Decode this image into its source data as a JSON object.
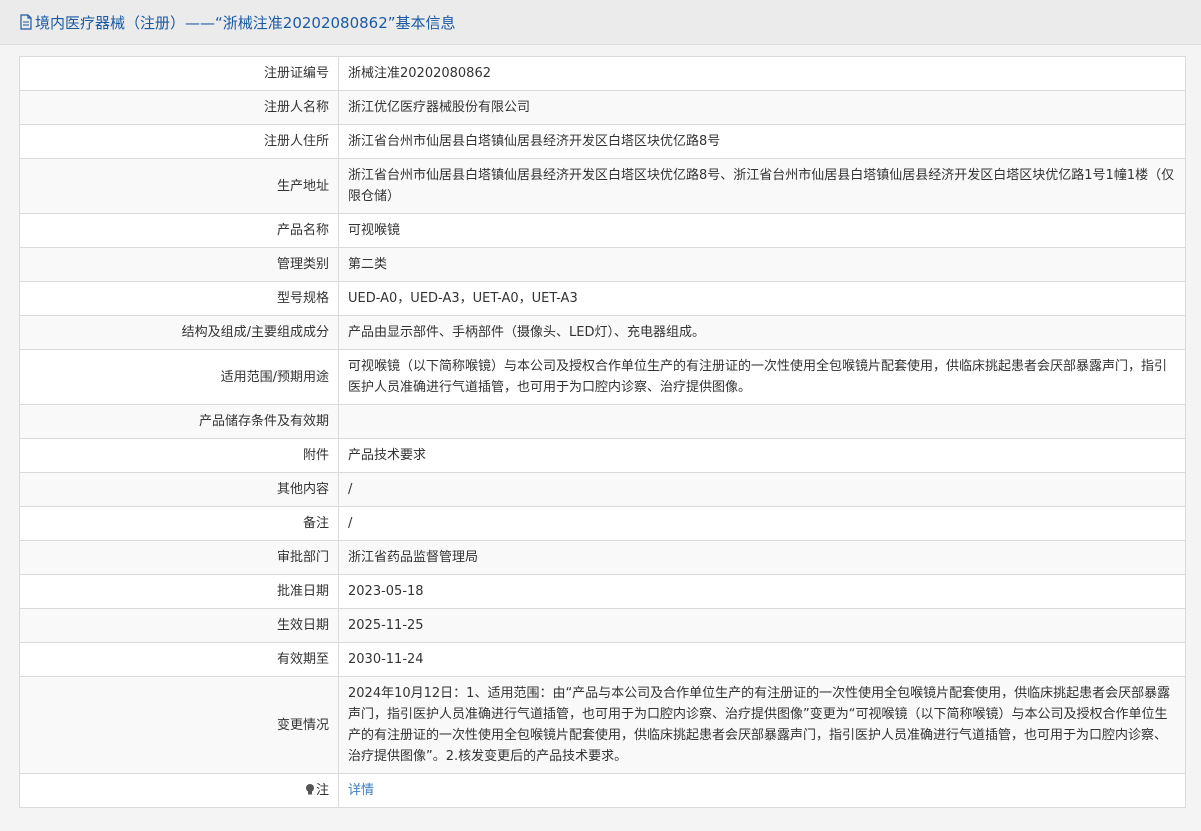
{
  "header": {
    "title": "境内医疗器械（注册）——“浙械注准20202080862”基本信息"
  },
  "rows": [
    {
      "label": "注册证编号",
      "value": "浙械注准20202080862"
    },
    {
      "label": "注册人名称",
      "value": "浙江优亿医疗器械股份有限公司"
    },
    {
      "label": "注册人住所",
      "value": "浙江省台州市仙居县白塔镇仙居县经济开发区白塔区块优亿路8号"
    },
    {
      "label": "生产地址",
      "value": "浙江省台州市仙居县白塔镇仙居县经济开发区白塔区块优亿路8号、浙江省台州市仙居县白塔镇仙居县经济开发区白塔区块优亿路1号1幢1楼（仅限仓储）"
    },
    {
      "label": "产品名称",
      "value": "可视喉镜"
    },
    {
      "label": "管理类别",
      "value": "第二类"
    },
    {
      "label": "型号规格",
      "value": "UED-A0，UED-A3，UET-A0，UET-A3"
    },
    {
      "label": "结构及组成/主要组成成分",
      "value": "产品由显示部件、手柄部件（摄像头、LED灯）、充电器组成。"
    },
    {
      "label": "适用范围/预期用途",
      "value": "可视喉镜（以下简称喉镜）与本公司及授权合作单位生产的有注册证的一次性使用全包喉镜片配套使用，供临床挑起患者会厌部暴露声门，指引医护人员准确进行气道插管，也可用于为口腔内诊察、治疗提供图像。"
    },
    {
      "label": "产品储存条件及有效期",
      "value": ""
    },
    {
      "label": "附件",
      "value": "产品技术要求"
    },
    {
      "label": "其他内容",
      "value": "/"
    },
    {
      "label": "备注",
      "value": "/"
    },
    {
      "label": "审批部门",
      "value": "浙江省药品监督管理局"
    },
    {
      "label": "批准日期",
      "value": "2023-05-18"
    },
    {
      "label": "生效日期",
      "value": "2025-11-25"
    },
    {
      "label": "有效期至",
      "value": "2030-11-24"
    },
    {
      "label": "变更情况",
      "value": "2024年10月12日：1、适用范围：由“产品与本公司及合作单位生产的有注册证的一次性使用全包喉镜片配套使用，供临床挑起患者会厌部暴露声门，指引医护人员准确进行气道插管，也可用于为口腔内诊察、治疗提供图像”变更为“可视喉镜（以下简称喉镜）与本公司及授权合作单位生产的有注册证的一次性使用全包喉镜片配套使用，供临床挑起患者会厌部暴露声门，指引医护人员准确进行气道插管，也可用于为口腔内诊察、治疗提供图像”。2.核发变更后的产品技术要求。"
    }
  ],
  "note": {
    "label": "注",
    "icon": "lightbulb-icon",
    "link_text": "详情"
  }
}
